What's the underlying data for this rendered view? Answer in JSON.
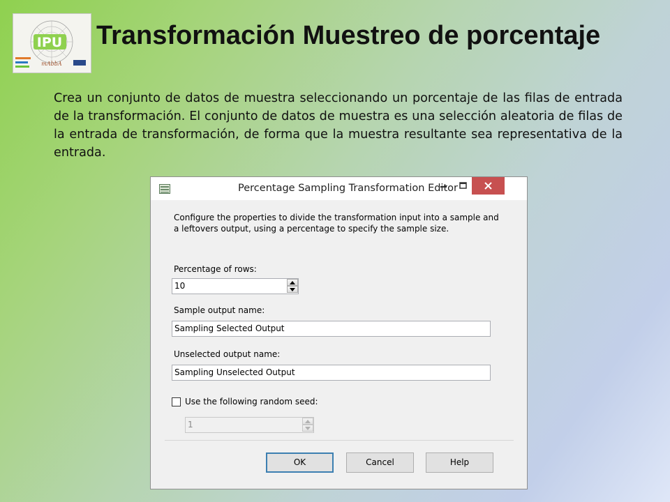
{
  "slide": {
    "title": "Transformación Muestreo de porcentaje",
    "body": "Crea un conjunto de datos de muestra seleccionando un porcentaje de las filas de entrada de la transformación. El conjunto de datos de muestra es una selección aleatoria de filas de la entrada de transformación, de forma que la muestra resultante sea representativa de la entrada."
  },
  "logo": {
    "text": "IPU",
    "accent_color": "#6bc43a"
  },
  "dialog": {
    "title": "Percentage Sampling Transformation Editor",
    "description": "Configure the properties to divide the transformation input into a sample and a leftovers output, using a percentage to specify the sample size.",
    "percentage_label": "Percentage of rows:",
    "percentage_value": "10",
    "sample_label": "Sample output name:",
    "sample_value": "Sampling Selected Output",
    "unselected_label": "Unselected output name:",
    "unselected_value": "Sampling Unselected Output",
    "seed_checkbox_label": "Use the following random seed:",
    "seed_checked": false,
    "seed_value": "1",
    "buttons": {
      "ok": "OK",
      "cancel": "Cancel",
      "help": "Help"
    },
    "close_color": "#c75050"
  }
}
